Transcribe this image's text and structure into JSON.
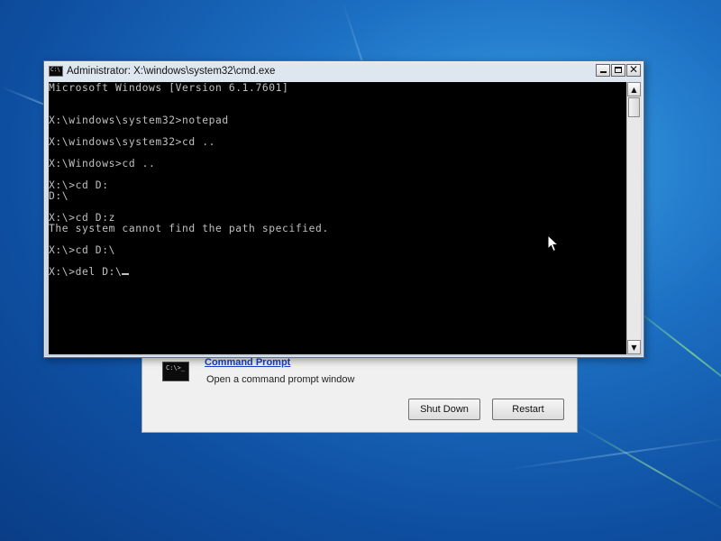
{
  "cmd_window": {
    "title": "Administrator: X:\\windows\\system32\\cmd.exe",
    "console_lines": [
      "Microsoft Windows [Version 6.1.7601]",
      "",
      "",
      "X:\\windows\\system32>notepad",
      "",
      "X:\\windows\\system32>cd ..",
      "",
      "X:\\Windows>cd ..",
      "",
      "X:\\>cd D:",
      "D:\\",
      "",
      "X:\\>cd D:z",
      "The system cannot find the path specified.",
      "",
      "X:\\>cd D:\\",
      "",
      "X:\\>del D:\\"
    ]
  },
  "recovery_dialog": {
    "icon_text": "C:\\>_",
    "option_title": "Command Prompt",
    "option_description": "Open a command prompt window",
    "shutdown_label": "Shut Down",
    "restart_label": "Restart"
  },
  "colors": {
    "console_bg": "#000000",
    "console_text": "#c0c0c0",
    "link": "#1c3ec4",
    "desktop": "#1c6fc2"
  }
}
